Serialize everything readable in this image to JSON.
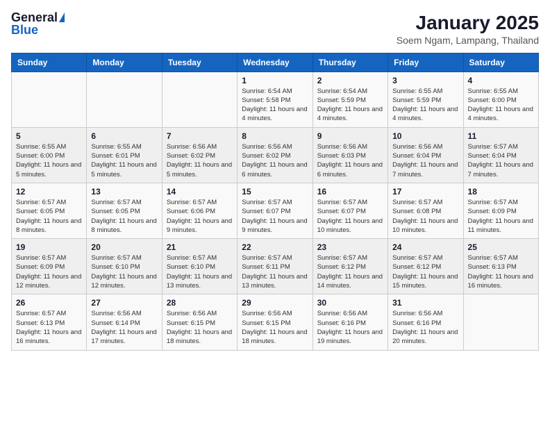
{
  "logo": {
    "general": "General",
    "blue": "Blue"
  },
  "title": "January 2025",
  "subtitle": "Soem Ngam, Lampang, Thailand",
  "weekdays": [
    "Sunday",
    "Monday",
    "Tuesday",
    "Wednesday",
    "Thursday",
    "Friday",
    "Saturday"
  ],
  "weeks": [
    [
      {
        "day": "",
        "sunrise": "",
        "sunset": "",
        "daylight": ""
      },
      {
        "day": "",
        "sunrise": "",
        "sunset": "",
        "daylight": ""
      },
      {
        "day": "",
        "sunrise": "",
        "sunset": "",
        "daylight": ""
      },
      {
        "day": "1",
        "sunrise": "Sunrise: 6:54 AM",
        "sunset": "Sunset: 5:58 PM",
        "daylight": "Daylight: 11 hours and 4 minutes."
      },
      {
        "day": "2",
        "sunrise": "Sunrise: 6:54 AM",
        "sunset": "Sunset: 5:59 PM",
        "daylight": "Daylight: 11 hours and 4 minutes."
      },
      {
        "day": "3",
        "sunrise": "Sunrise: 6:55 AM",
        "sunset": "Sunset: 5:59 PM",
        "daylight": "Daylight: 11 hours and 4 minutes."
      },
      {
        "day": "4",
        "sunrise": "Sunrise: 6:55 AM",
        "sunset": "Sunset: 6:00 PM",
        "daylight": "Daylight: 11 hours and 4 minutes."
      }
    ],
    [
      {
        "day": "5",
        "sunrise": "Sunrise: 6:55 AM",
        "sunset": "Sunset: 6:00 PM",
        "daylight": "Daylight: 11 hours and 5 minutes."
      },
      {
        "day": "6",
        "sunrise": "Sunrise: 6:55 AM",
        "sunset": "Sunset: 6:01 PM",
        "daylight": "Daylight: 11 hours and 5 minutes."
      },
      {
        "day": "7",
        "sunrise": "Sunrise: 6:56 AM",
        "sunset": "Sunset: 6:02 PM",
        "daylight": "Daylight: 11 hours and 5 minutes."
      },
      {
        "day": "8",
        "sunrise": "Sunrise: 6:56 AM",
        "sunset": "Sunset: 6:02 PM",
        "daylight": "Daylight: 11 hours and 6 minutes."
      },
      {
        "day": "9",
        "sunrise": "Sunrise: 6:56 AM",
        "sunset": "Sunset: 6:03 PM",
        "daylight": "Daylight: 11 hours and 6 minutes."
      },
      {
        "day": "10",
        "sunrise": "Sunrise: 6:56 AM",
        "sunset": "Sunset: 6:04 PM",
        "daylight": "Daylight: 11 hours and 7 minutes."
      },
      {
        "day": "11",
        "sunrise": "Sunrise: 6:57 AM",
        "sunset": "Sunset: 6:04 PM",
        "daylight": "Daylight: 11 hours and 7 minutes."
      }
    ],
    [
      {
        "day": "12",
        "sunrise": "Sunrise: 6:57 AM",
        "sunset": "Sunset: 6:05 PM",
        "daylight": "Daylight: 11 hours and 8 minutes."
      },
      {
        "day": "13",
        "sunrise": "Sunrise: 6:57 AM",
        "sunset": "Sunset: 6:05 PM",
        "daylight": "Daylight: 11 hours and 8 minutes."
      },
      {
        "day": "14",
        "sunrise": "Sunrise: 6:57 AM",
        "sunset": "Sunset: 6:06 PM",
        "daylight": "Daylight: 11 hours and 9 minutes."
      },
      {
        "day": "15",
        "sunrise": "Sunrise: 6:57 AM",
        "sunset": "Sunset: 6:07 PM",
        "daylight": "Daylight: 11 hours and 9 minutes."
      },
      {
        "day": "16",
        "sunrise": "Sunrise: 6:57 AM",
        "sunset": "Sunset: 6:07 PM",
        "daylight": "Daylight: 11 hours and 10 minutes."
      },
      {
        "day": "17",
        "sunrise": "Sunrise: 6:57 AM",
        "sunset": "Sunset: 6:08 PM",
        "daylight": "Daylight: 11 hours and 10 minutes."
      },
      {
        "day": "18",
        "sunrise": "Sunrise: 6:57 AM",
        "sunset": "Sunset: 6:09 PM",
        "daylight": "Daylight: 11 hours and 11 minutes."
      }
    ],
    [
      {
        "day": "19",
        "sunrise": "Sunrise: 6:57 AM",
        "sunset": "Sunset: 6:09 PM",
        "daylight": "Daylight: 11 hours and 12 minutes."
      },
      {
        "day": "20",
        "sunrise": "Sunrise: 6:57 AM",
        "sunset": "Sunset: 6:10 PM",
        "daylight": "Daylight: 11 hours and 12 minutes."
      },
      {
        "day": "21",
        "sunrise": "Sunrise: 6:57 AM",
        "sunset": "Sunset: 6:10 PM",
        "daylight": "Daylight: 11 hours and 13 minutes."
      },
      {
        "day": "22",
        "sunrise": "Sunrise: 6:57 AM",
        "sunset": "Sunset: 6:11 PM",
        "daylight": "Daylight: 11 hours and 13 minutes."
      },
      {
        "day": "23",
        "sunrise": "Sunrise: 6:57 AM",
        "sunset": "Sunset: 6:12 PM",
        "daylight": "Daylight: 11 hours and 14 minutes."
      },
      {
        "day": "24",
        "sunrise": "Sunrise: 6:57 AM",
        "sunset": "Sunset: 6:12 PM",
        "daylight": "Daylight: 11 hours and 15 minutes."
      },
      {
        "day": "25",
        "sunrise": "Sunrise: 6:57 AM",
        "sunset": "Sunset: 6:13 PM",
        "daylight": "Daylight: 11 hours and 16 minutes."
      }
    ],
    [
      {
        "day": "26",
        "sunrise": "Sunrise: 6:57 AM",
        "sunset": "Sunset: 6:13 PM",
        "daylight": "Daylight: 11 hours and 16 minutes."
      },
      {
        "day": "27",
        "sunrise": "Sunrise: 6:56 AM",
        "sunset": "Sunset: 6:14 PM",
        "daylight": "Daylight: 11 hours and 17 minutes."
      },
      {
        "day": "28",
        "sunrise": "Sunrise: 6:56 AM",
        "sunset": "Sunset: 6:15 PM",
        "daylight": "Daylight: 11 hours and 18 minutes."
      },
      {
        "day": "29",
        "sunrise": "Sunrise: 6:56 AM",
        "sunset": "Sunset: 6:15 PM",
        "daylight": "Daylight: 11 hours and 18 minutes."
      },
      {
        "day": "30",
        "sunrise": "Sunrise: 6:56 AM",
        "sunset": "Sunset: 6:16 PM",
        "daylight": "Daylight: 11 hours and 19 minutes."
      },
      {
        "day": "31",
        "sunrise": "Sunrise: 6:56 AM",
        "sunset": "Sunset: 6:16 PM",
        "daylight": "Daylight: 11 hours and 20 minutes."
      },
      {
        "day": "",
        "sunrise": "",
        "sunset": "",
        "daylight": ""
      }
    ]
  ]
}
